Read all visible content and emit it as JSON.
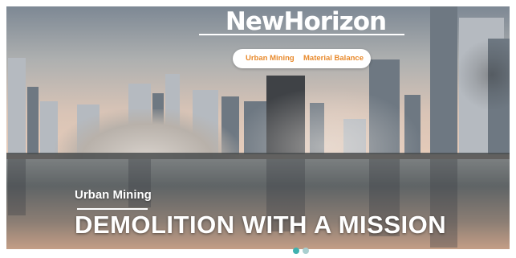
{
  "brand": {
    "logo_text": "NewHorizon"
  },
  "nav": {
    "items": [
      {
        "label": "Urban Mining"
      },
      {
        "label": "Material Balance"
      }
    ]
  },
  "hero": {
    "subtitle": "Urban Mining",
    "headline": "DEMOLITION WITH A MISSION"
  },
  "carousel": {
    "slide_count": 2,
    "active_index": 0,
    "active_color": "#3fb2b0",
    "inactive_color": "#a9cfcf"
  },
  "colors": {
    "accent": "#e8892b",
    "text_light": "#ffffff"
  }
}
